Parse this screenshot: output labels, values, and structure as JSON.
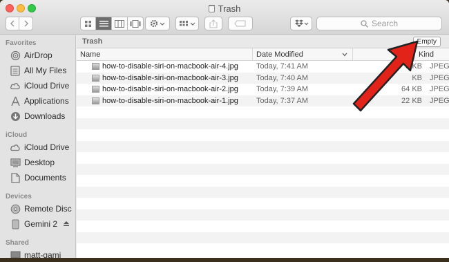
{
  "window": {
    "title": "Trash"
  },
  "toolbar": {
    "back_icon": "chevron-left-icon",
    "forward_icon": "chevron-right-icon",
    "view_modes": [
      "icon-view-icon",
      "list-view-icon",
      "column-view-icon",
      "cover-flow-icon"
    ],
    "active_view": "list",
    "search_placeholder": "Search"
  },
  "sidebar": {
    "sections": [
      {
        "title": "Favorites",
        "items": [
          {
            "label": "AirDrop",
            "icon": "airdrop-icon"
          },
          {
            "label": "All My Files",
            "icon": "all-files-icon"
          },
          {
            "label": "iCloud Drive",
            "icon": "cloud-icon"
          },
          {
            "label": "Applications",
            "icon": "applications-icon"
          },
          {
            "label": "Downloads",
            "icon": "downloads-icon"
          }
        ]
      },
      {
        "title": "iCloud",
        "items": [
          {
            "label": "iCloud Drive",
            "icon": "cloud-icon"
          },
          {
            "label": "Desktop",
            "icon": "desktop-icon"
          },
          {
            "label": "Documents",
            "icon": "documents-icon"
          }
        ]
      },
      {
        "title": "Devices",
        "items": [
          {
            "label": "Remote Disc",
            "icon": "disc-icon"
          },
          {
            "label": "Gemini 2",
            "icon": "drive-icon"
          }
        ]
      },
      {
        "title": "Shared",
        "items": [
          {
            "label": "matt-gami",
            "icon": "computer-icon"
          }
        ]
      }
    ]
  },
  "pathbar": {
    "location": "Trash",
    "empty_label": "Empty"
  },
  "columns": {
    "name": "Name",
    "date": "Date Modified",
    "size": "Size",
    "kind": "Kind"
  },
  "files": [
    {
      "name": "how-to-disable-siri-on-macbook-air-4.jpg",
      "date": "Today, 7:41 AM",
      "size": "5 KB",
      "kind": "JPEG ima"
    },
    {
      "name": "how-to-disable-siri-on-macbook-air-3.jpg",
      "date": "Today, 7:40 AM",
      "size": "KB",
      "kind": "JPEG ima"
    },
    {
      "name": "how-to-disable-siri-on-macbook-air-2.jpg",
      "date": "Today, 7:39 AM",
      "size": "64 KB",
      "kind": "JPEG ima"
    },
    {
      "name": "how-to-disable-siri-on-macbook-air-1.jpg",
      "date": "Today, 7:37 AM",
      "size": "22 KB",
      "kind": "JPEG ima"
    }
  ],
  "annotation": {
    "arrow_color": "#e2231a"
  }
}
